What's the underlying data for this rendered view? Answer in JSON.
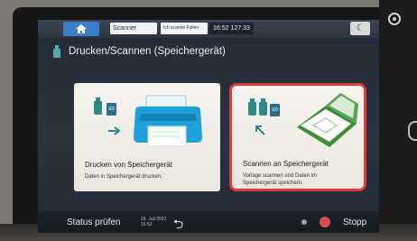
{
  "topbar": {
    "home_icon": "home-icon",
    "app_field": "Scanner",
    "user_field": "Ich scanne Folien",
    "time": "16:52 127:33",
    "night_icon": "moon-icon"
  },
  "header": {
    "title": "Drucken/Scannen (Speichergerät)"
  },
  "cards": [
    {
      "title": "Drucken von Speichergerät",
      "description": "Daten in Speichergerät drucken.",
      "sd_label": "SD"
    },
    {
      "title": "Scannen an Speichergerät",
      "description": "Vorlage scannen und Daten im Speichergerät speichern.",
      "sd_label": "SD"
    }
  ],
  "statusbar": {
    "status_label": "Status prüfen",
    "date_line1": "29. Juli 2022",
    "date_line2": "16:52",
    "stop_label": "Stopp"
  },
  "colors": {
    "accent_blue": "#3a7fc9",
    "highlight_red": "#e0393e",
    "teal": "#2d8a87",
    "scanner_green": "#3f8e3c"
  }
}
